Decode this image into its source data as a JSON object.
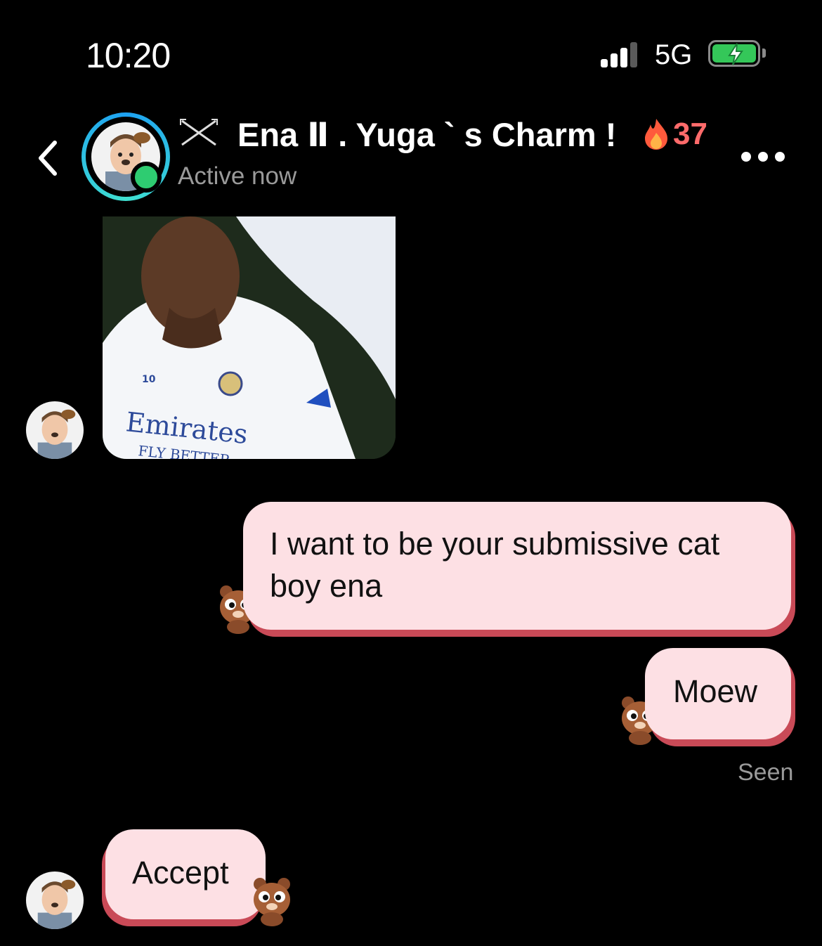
{
  "status_bar": {
    "time": "10:20",
    "network": "5G",
    "signal_bars": 3,
    "battery": "charging"
  },
  "header": {
    "title": "Ena Ⅱ . Yuga ` s Charm !",
    "streak_count": "37",
    "subtitle": "Active now"
  },
  "messages": [
    {
      "from": "them",
      "type": "image"
    },
    {
      "from": "me",
      "type": "text",
      "text": "I want to be your submissive cat boy ena"
    },
    {
      "from": "me",
      "type": "text",
      "text": "Moew"
    },
    {
      "from": "them",
      "type": "text",
      "text": "Accept"
    }
  ],
  "read_receipt": "Seen",
  "media": {
    "jersey_text": "Emirates",
    "jersey_subtext": "FLY BETTER",
    "number": "10"
  },
  "colors": {
    "bubble": "#fde0e4",
    "bubble_shadow": "#c94a57",
    "online": "#2ecc71",
    "streak": "#ff6b6b"
  }
}
